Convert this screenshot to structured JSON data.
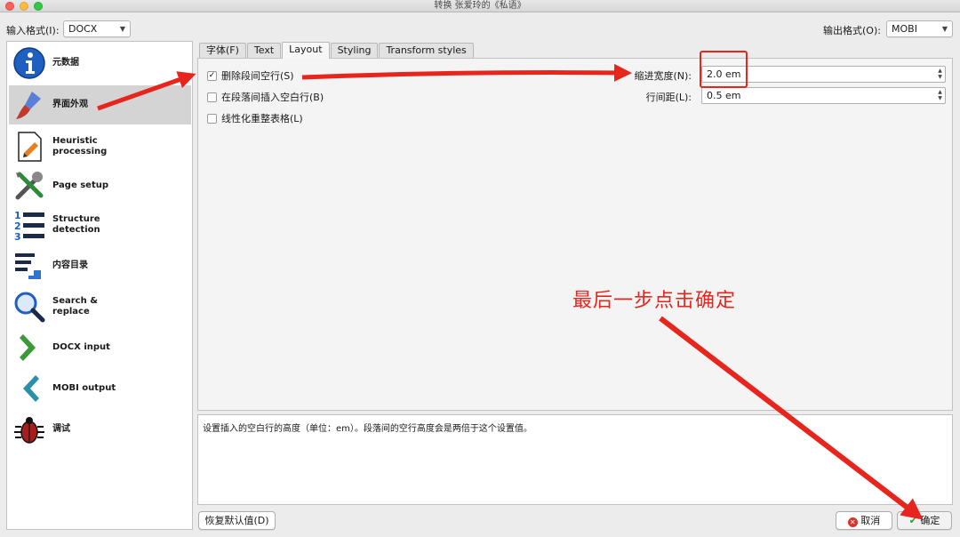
{
  "window": {
    "title": "转换 张爱玲的《私语》"
  },
  "formats": {
    "input_label": "输入格式(I):",
    "input_value": "DOCX",
    "output_label": "输出格式(O):",
    "output_value": "MOBI"
  },
  "sidebar": {
    "items": [
      {
        "label": "元数据",
        "icon": "info-icon"
      },
      {
        "label": "界面外观",
        "icon": "brush-icon"
      },
      {
        "label": "Heuristic\nprocessing",
        "icon": "document-icon"
      },
      {
        "label": "Page setup",
        "icon": "tools-icon"
      },
      {
        "label": "Structure\ndetection",
        "icon": "numbered-list-icon"
      },
      {
        "label": "内容目录",
        "icon": "toc-icon"
      },
      {
        "label": "Search &\nreplace",
        "icon": "magnifier-icon"
      },
      {
        "label": "DOCX input",
        "icon": "chevron-right-icon"
      },
      {
        "label": "MOBI output",
        "icon": "chevron-left-icon"
      },
      {
        "label": "调试",
        "icon": "bug-icon"
      }
    ]
  },
  "tabs": [
    {
      "label": "字体(F)"
    },
    {
      "label": "Text"
    },
    {
      "label": "Layout"
    },
    {
      "label": "Styling"
    },
    {
      "label": "Transform styles"
    }
  ],
  "layout": {
    "remove_blank_lines": {
      "label": "删除段间空行(S)",
      "checked": true
    },
    "insert_blank_line": {
      "label": "在段落间插入空白行(B)",
      "checked": false
    },
    "linearize_tables": {
      "label": "线性化重整表格(L)",
      "checked": false
    },
    "indent_label": "缩进宽度(N):",
    "indent_value": "2.0 em",
    "line_spacing_label": "行间距(L):",
    "line_spacing_value": "0.5 em"
  },
  "description": "设置插入的空白行的高度（单位：em）。段落间的空行高度会是两倍于这个设置值。",
  "buttons": {
    "restore_defaults": "恢复默认值(D)",
    "cancel": "取消",
    "ok": "确定"
  },
  "annotation": {
    "text": "最后一步点击确定",
    "color": "#e8251d"
  }
}
